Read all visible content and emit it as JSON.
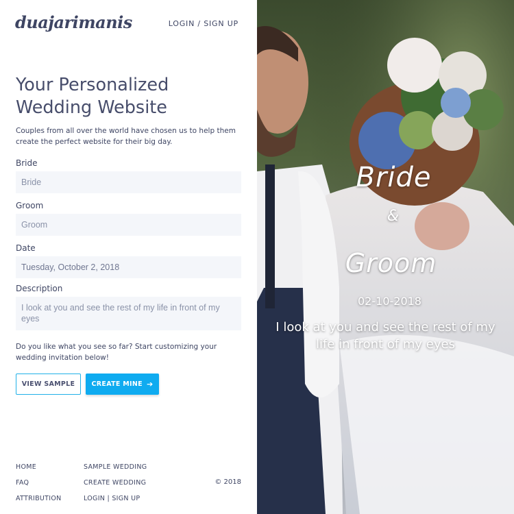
{
  "brand": {
    "logo_text": "duajarimanis"
  },
  "header": {
    "auth_link": "LOGIN / SIGN UP"
  },
  "hero": {
    "title": "Your Personalized Wedding Website",
    "subtitle": "Couples from all over the world have chosen us to help them create the perfect website for their big day."
  },
  "form": {
    "bride": {
      "label": "Bride",
      "placeholder": "Bride"
    },
    "groom": {
      "label": "Groom",
      "placeholder": "Groom"
    },
    "date": {
      "label": "Date",
      "value": "Tuesday, October 2, 2018"
    },
    "description": {
      "label": "Description",
      "placeholder": "I look at you and see the rest of my life in front of my eyes"
    }
  },
  "prompt": "Do you like what you see so far? Start customizing your wedding invitation below!",
  "actions": {
    "view_sample": "VIEW SAMPLE",
    "create_mine": "CREATE MINE",
    "create_icon": "arrow-right-icon"
  },
  "footer": {
    "col1": [
      "HOME",
      "FAQ",
      "ATTRIBUTION"
    ],
    "col2": [
      "SAMPLE WEDDING",
      "CREATE WEDDING",
      "LOGIN | SIGN UP"
    ],
    "copyright": "© 2018"
  },
  "preview": {
    "bride": "Bride",
    "ampersand": "&",
    "groom": "Groom",
    "date": "02-10-2018",
    "description": "I look at you and see the rest of my life in front of my eyes"
  },
  "colors": {
    "text": "#3e4563",
    "accent": "#0fabf0",
    "field_bg": "#f4f6fa"
  }
}
